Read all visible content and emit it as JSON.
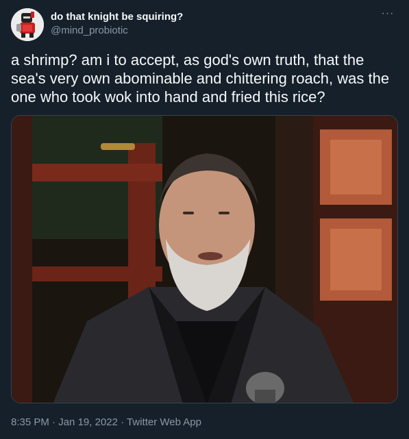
{
  "author": {
    "display_name": "do that knight be squiring?",
    "handle": "@mind_probiotic"
  },
  "more_glyph": "···",
  "tweet": {
    "text": "a shrimp? am i to accept, as god's own truth, that the sea's very own abominable and chittering roach, was the one who took wok into hand and fried this rice?"
  },
  "media": {
    "icon": "photo-icon"
  },
  "meta": {
    "time": "8:35 PM",
    "sep1": " · ",
    "date": "Jan 19, 2022",
    "sep2": " · ",
    "source": "Twitter Web App"
  },
  "colors": {
    "background": "#15202b",
    "text_primary": "#f7f9f9",
    "text_secondary": "#8b98a5",
    "border": "#38444d"
  }
}
